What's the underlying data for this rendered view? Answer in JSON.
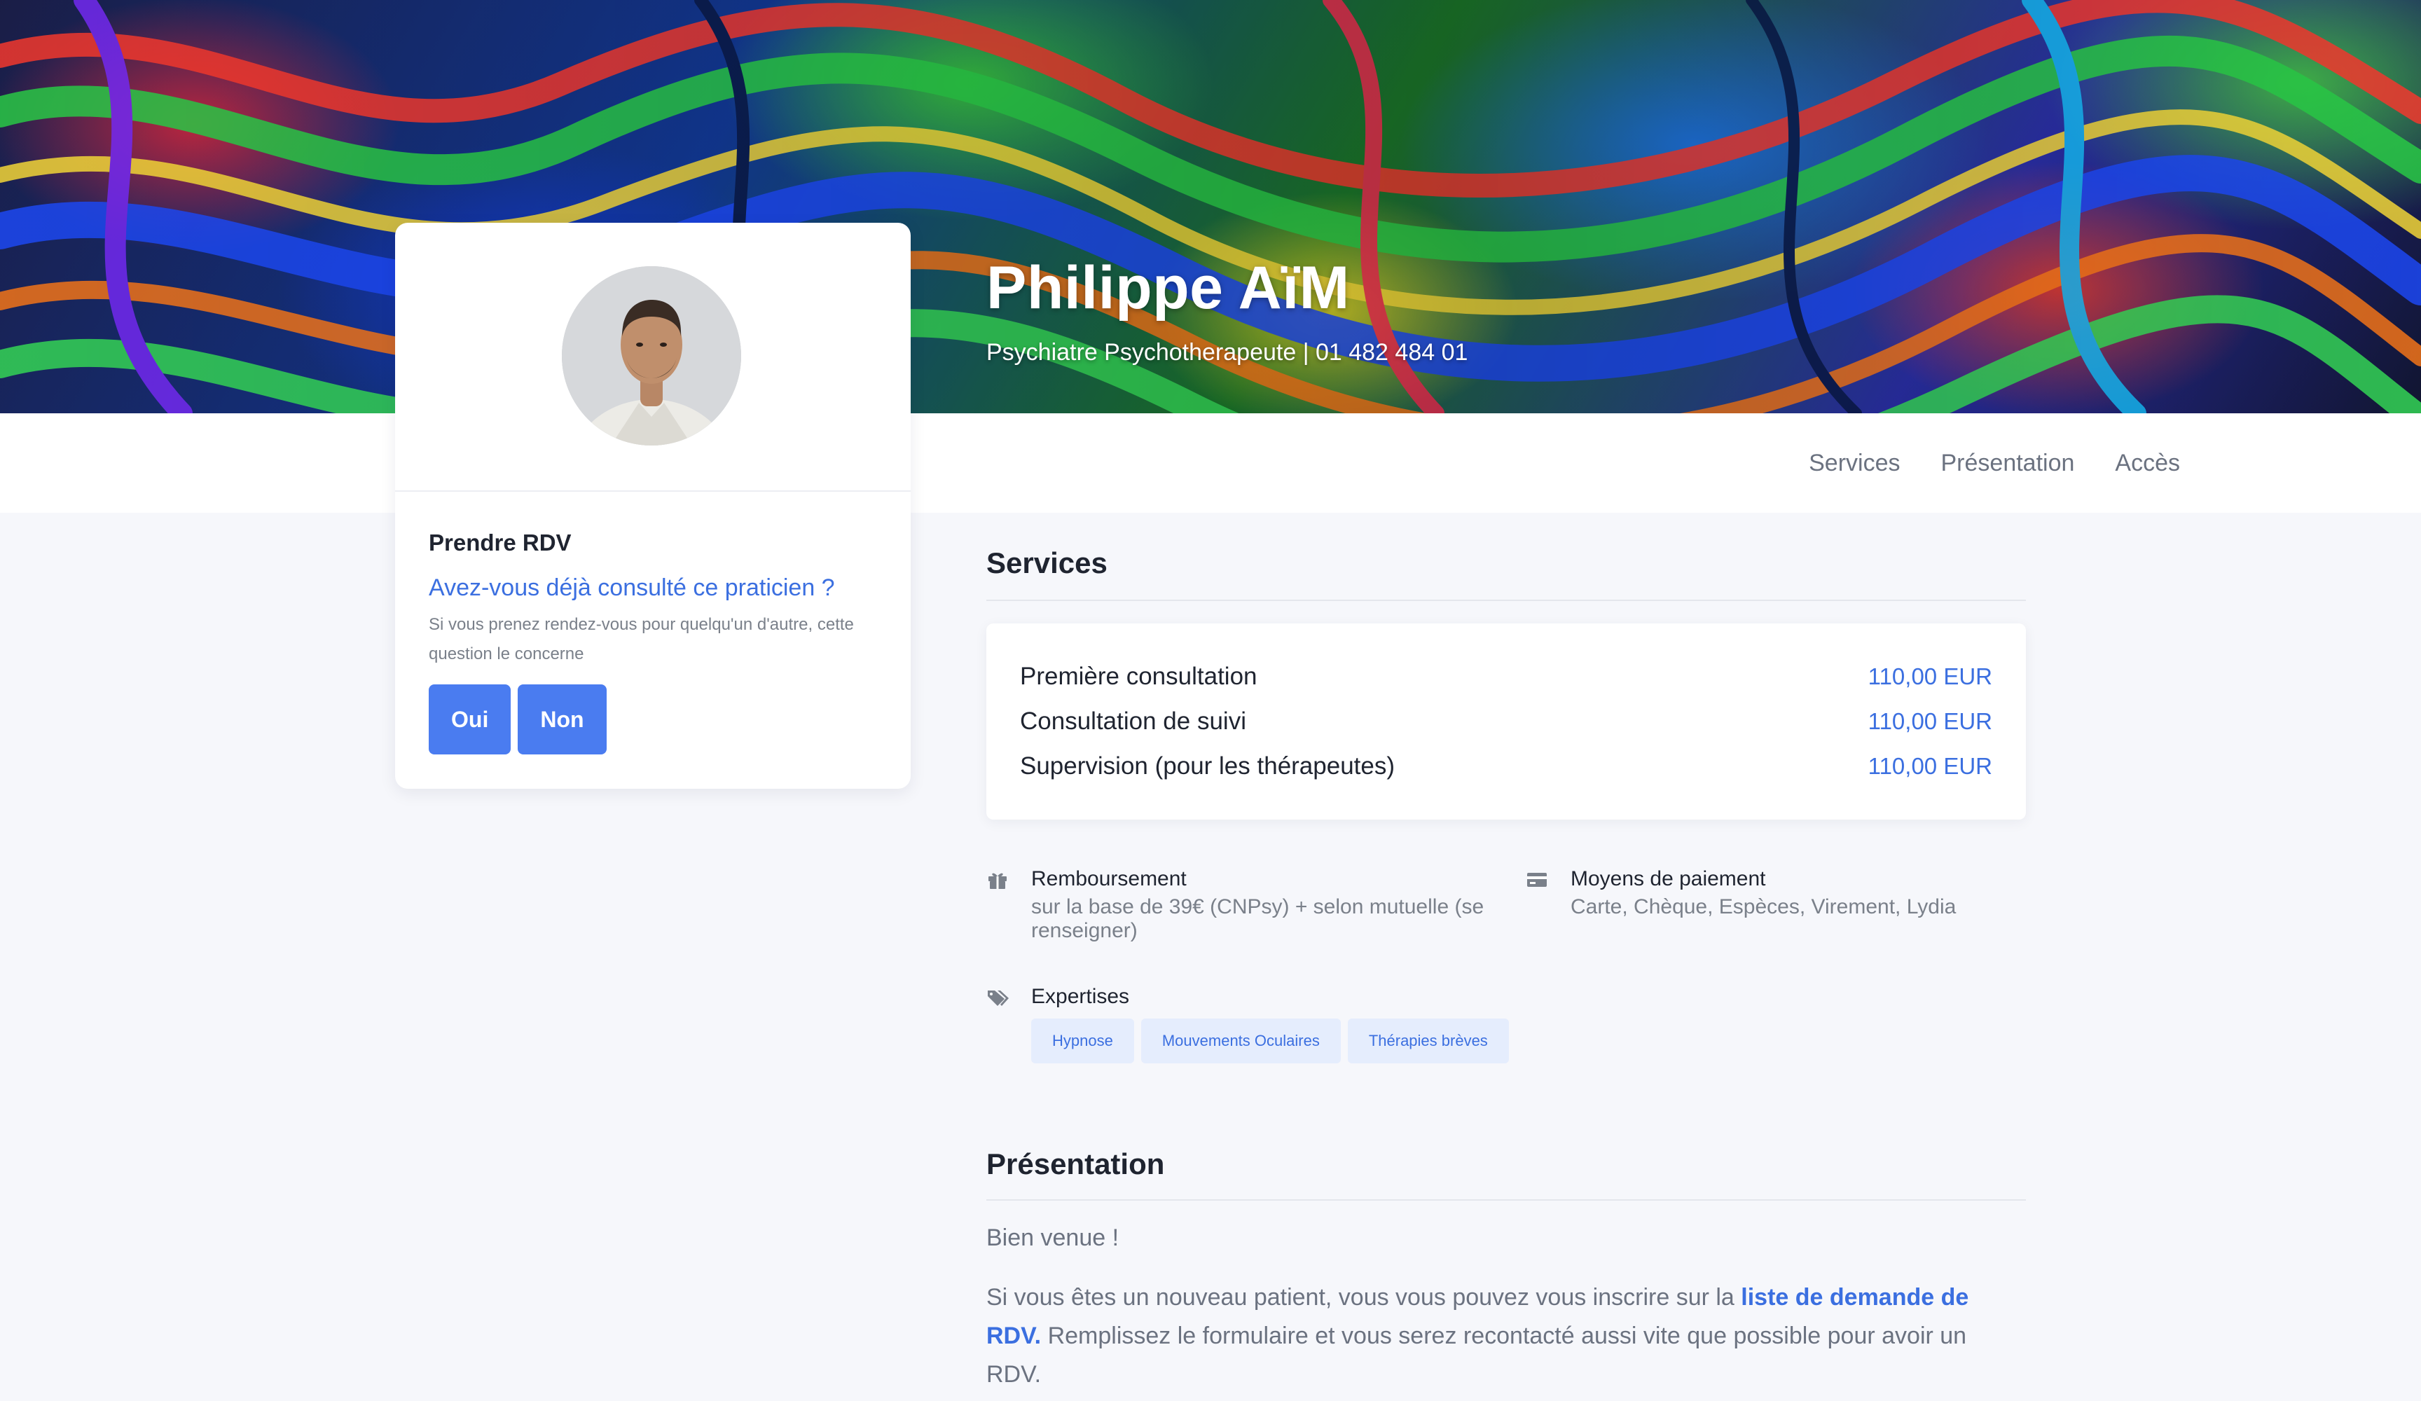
{
  "hero": {
    "name": "Philippe AïM",
    "subtitle": "Psychiatre Psychotherapeute | 01 482 484 01"
  },
  "nav": {
    "items": [
      "Services",
      "Présentation",
      "Accès"
    ]
  },
  "profile": {
    "avatar_icon": "doctor-portrait",
    "rdv_title": "Prendre RDV",
    "rdv_question": "Avez-vous déjà consulté ce praticien ?",
    "rdv_hint": "Si vous prenez rendez-vous pour quelqu'un d'autre, cette question le concerne",
    "yes_label": "Oui",
    "no_label": "Non"
  },
  "services": {
    "title": "Services",
    "items": [
      {
        "name": "Première consultation",
        "price": "110,00 EUR"
      },
      {
        "name": "Consultation de suivi",
        "price": "110,00 EUR"
      },
      {
        "name": "Supervision (pour les thérapeutes)",
        "price": "110,00 EUR"
      }
    ],
    "reimbursement": {
      "icon": "gift-icon",
      "label": "Remboursement",
      "text": "sur la base de 39€ (CNPsy) + selon mutuelle (se renseigner)"
    },
    "payment": {
      "icon": "credit-card-icon",
      "label": "Moyens de paiement",
      "text": "Carte, Chèque, Espèces, Virement, Lydia"
    },
    "expertise": {
      "icon": "tags-icon",
      "label": "Expertises",
      "tags": [
        "Hypnose",
        "Mouvements Oculaires",
        "Thérapies brèves"
      ]
    }
  },
  "presentation": {
    "title": "Présentation",
    "greeting": "Bien venue !",
    "para_before": "Si vous êtes un nouveau patient, vous vous pouvez vous inscrire sur la ",
    "link_text": "liste de demande de RDV.",
    "para_after": " Remplissez le formulaire et vous serez recontacté aussi vite que possible pour avoir un RDV."
  },
  "colors": {
    "accent": "#4a7cf0",
    "link": "#3b6fe0",
    "background": "#f6f7fb",
    "tag_bg": "#e5edfd"
  }
}
